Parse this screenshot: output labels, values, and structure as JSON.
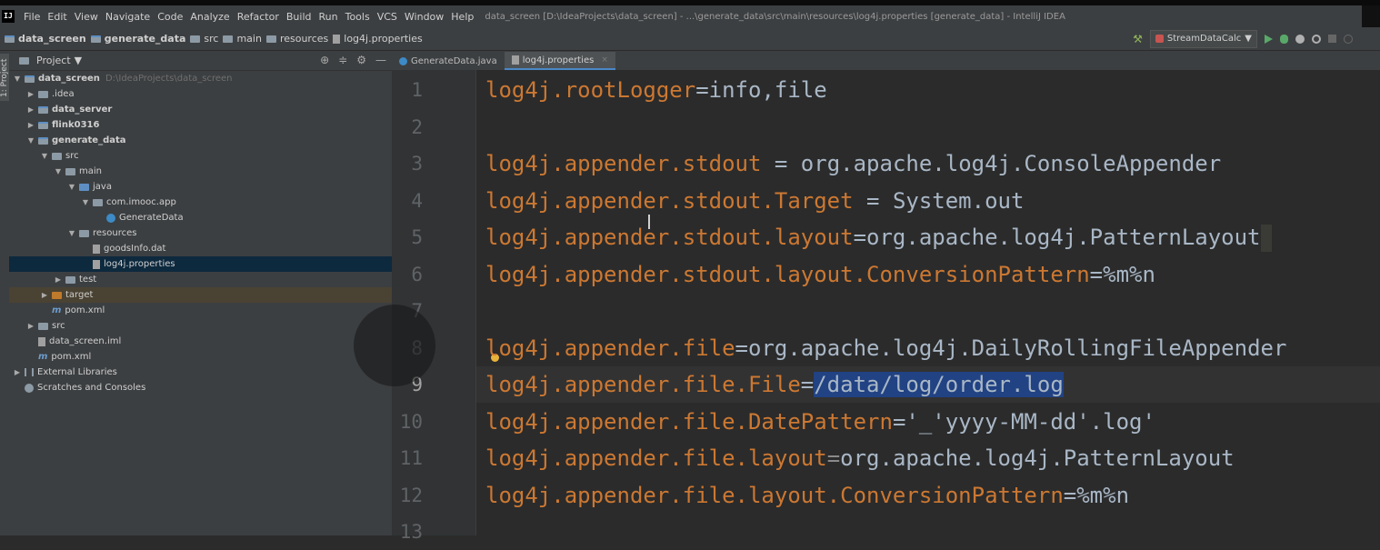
{
  "window": {
    "title": "data_screen [D:\\IdeaProjects\\data_screen] - ...\\generate_data\\src\\main\\resources\\log4j.properties [generate_data] - IntelliJ IDEA",
    "logo_text": "IJ"
  },
  "menu": [
    "File",
    "Edit",
    "View",
    "Navigate",
    "Code",
    "Analyze",
    "Refactor",
    "Build",
    "Run",
    "Tools",
    "VCS",
    "Window",
    "Help"
  ],
  "breadcrumb": [
    "data_screen",
    "generate_data",
    "src",
    "main",
    "resources",
    "log4j.properties"
  ],
  "toolbar": {
    "run_config": "StreamDataCalc",
    "run_config_arrow": "▼",
    "hammer": "⚒"
  },
  "side_tab": "1: Project",
  "project_panel": {
    "title": "Project",
    "title_arrow": "▼",
    "icons": [
      "⊕",
      "≑",
      "⚙",
      "—"
    ],
    "tree": [
      {
        "label": "data_screen",
        "extra": "D:\\IdeaProjects\\data_screen",
        "arrow": "▼",
        "icon": "folder-module",
        "bold": true
      },
      {
        "label": ".idea",
        "arrow": "▶",
        "icon": "folder"
      },
      {
        "label": "data_server",
        "arrow": "▶",
        "icon": "folder-module",
        "bold": true
      },
      {
        "label": "flink0316",
        "arrow": "▶",
        "icon": "folder-module",
        "bold": true
      },
      {
        "label": "generate_data",
        "arrow": "▼",
        "icon": "folder-module",
        "bold": true
      },
      {
        "label": "src",
        "arrow": "▼",
        "icon": "folder"
      },
      {
        "label": "main",
        "arrow": "▼",
        "icon": "folder"
      },
      {
        "label": "java",
        "arrow": "▼",
        "icon": "folder-blue"
      },
      {
        "label": "com.imooc.app",
        "arrow": "▼",
        "icon": "folder"
      },
      {
        "label": "GenerateData",
        "arrow": "",
        "icon": "class"
      },
      {
        "label": "resources",
        "arrow": "▼",
        "icon": "folder"
      },
      {
        "label": "goodsInfo.dat",
        "arrow": "",
        "icon": "file"
      },
      {
        "label": "log4j.properties",
        "arrow": "",
        "icon": "file"
      },
      {
        "label": "test",
        "arrow": "▶",
        "icon": "folder"
      },
      {
        "label": "target",
        "arrow": "▶",
        "icon": "folder-orange"
      },
      {
        "label": "pom.xml",
        "arrow": "",
        "icon": "maven"
      },
      {
        "label": "src",
        "arrow": "▶",
        "icon": "folder"
      },
      {
        "label": "data_screen.iml",
        "arrow": "",
        "icon": "file"
      },
      {
        "label": "pom.xml",
        "arrow": "",
        "icon": "maven"
      },
      {
        "label": "External Libraries",
        "arrow": "▶",
        "icon": "lib"
      },
      {
        "label": "Scratches and Consoles",
        "arrow": "",
        "icon": "scratch"
      }
    ],
    "selected_index": 12,
    "excluded_index": 14
  },
  "tabs": [
    {
      "label": "GenerateData.java",
      "icon": "class",
      "active": false
    },
    {
      "label": "log4j.properties",
      "icon": "properties",
      "active": true,
      "close": "×"
    }
  ],
  "editor": {
    "current_line": 9,
    "lines": [
      {
        "n": "1",
        "key": "log4j.rootLogger",
        "sep": "=",
        "val": "info,file"
      },
      {
        "n": "2",
        "key": "",
        "sep": "",
        "val": ""
      },
      {
        "n": "3",
        "key": "log4j.appender.stdout",
        "sep": " = ",
        "val": "org.apache.log4j.ConsoleAppender"
      },
      {
        "n": "4",
        "key": "log4j.appender.stdout.Target",
        "sep": " = ",
        "val": "System.out"
      },
      {
        "n": "5",
        "key": "log4j.appender.stdout.layout",
        "sep": "=",
        "val": "org.apache.log4j.PatternLayout"
      },
      {
        "n": "6",
        "key": "log4j.appender.stdout.layout.ConversionPattern",
        "sep": "=",
        "val": "%m%n"
      },
      {
        "n": "7",
        "key": "",
        "sep": "",
        "val": ""
      },
      {
        "n": "8",
        "key": "log4j.appender.file",
        "sep": "=",
        "val": "org.apache.log4j.DailyRollingFileAppender"
      },
      {
        "n": "9",
        "key": "log4j.appender.file.File",
        "sep": "=",
        "val": "/data/log/order.log"
      },
      {
        "n": "10",
        "key": "log4j.appender.file.DatePattern",
        "sep": "=",
        "val": "'_'yyyy-MM-dd'.log'"
      },
      {
        "n": "11",
        "key": "log4j.appender.file.layout",
        "sep": "=",
        "val": "org.apache.log4j.PatternLayout"
      },
      {
        "n": "12",
        "key": "log4j.appender.file.layout.ConversionPattern",
        "sep": "=",
        "val": "%m%n"
      },
      {
        "n": "13",
        "key": "",
        "sep": "",
        "val": ""
      }
    ]
  },
  "colors": {
    "key": "#cc7832",
    "value": "#a9b7c6",
    "selection": "#214283",
    "background": "#2b2b2b"
  }
}
